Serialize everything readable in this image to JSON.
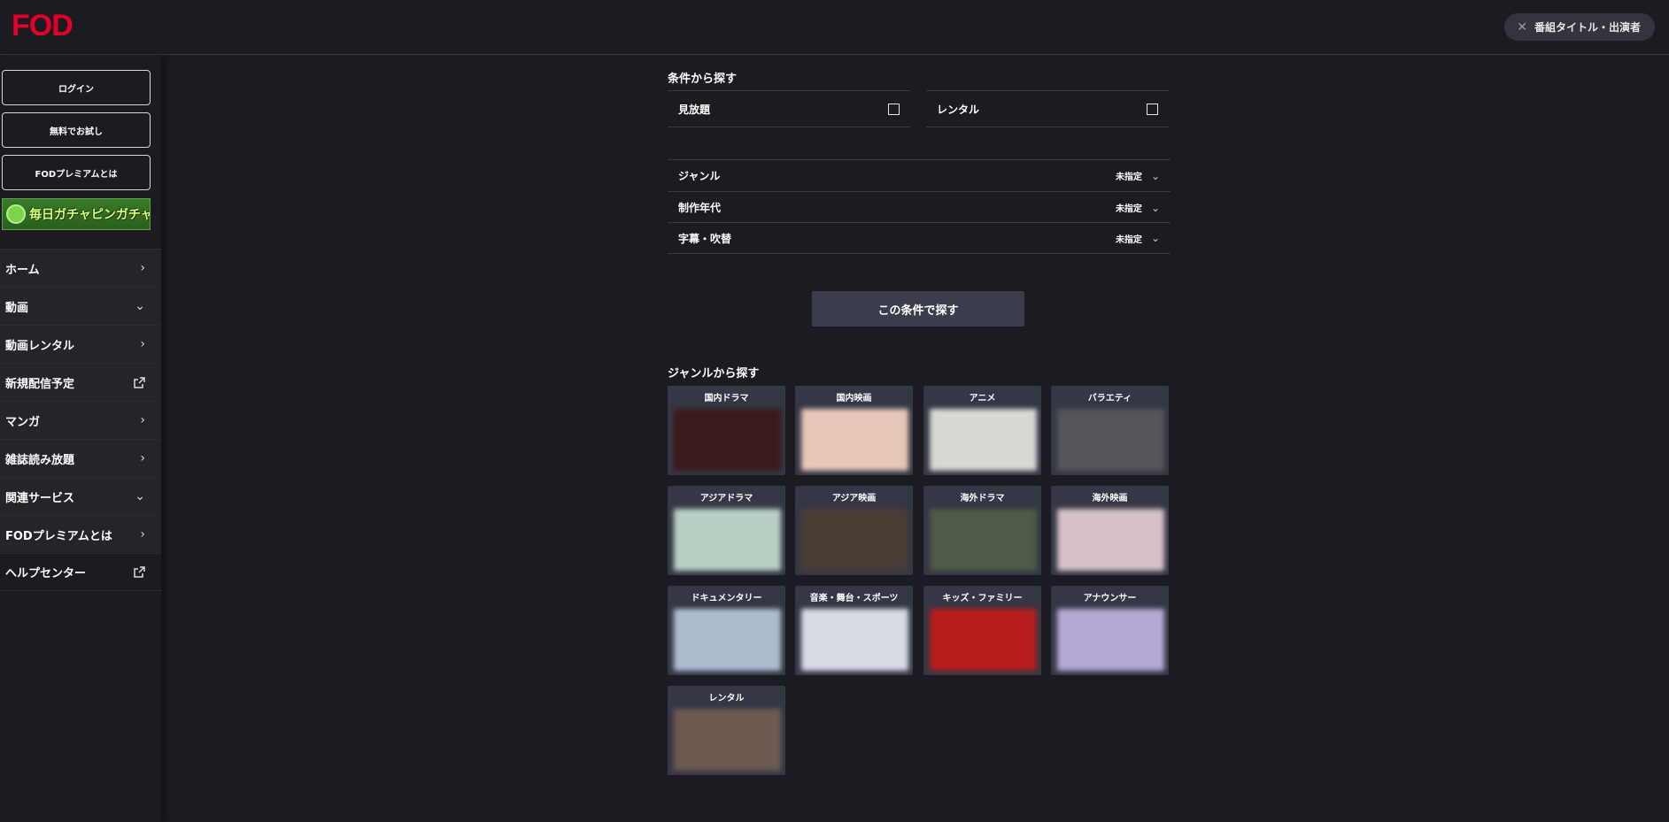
{
  "header": {
    "logo": "FOD",
    "search_chip": {
      "icon": "close-icon",
      "label": "番組タイトル・出演者"
    }
  },
  "sidebar": {
    "buttons": [
      "ログイン",
      "無料でお試し",
      "FODプレミアムとは"
    ],
    "banner": {
      "text": "毎日ガチャピンガチャ"
    },
    "nav": [
      {
        "label": "ホーム",
        "icon": "chevron-right-icon"
      },
      {
        "label": "動画",
        "icon": "chevron-down-icon"
      },
      {
        "label": "動画レンタル",
        "icon": "chevron-right-icon"
      },
      {
        "label": "新規配信予定",
        "icon": "external-link-icon"
      },
      {
        "label": "マンガ",
        "icon": "chevron-right-icon"
      },
      {
        "label": "雑誌読み放題",
        "icon": "chevron-right-icon"
      },
      {
        "label": "関連サービス",
        "icon": "chevron-down-icon"
      },
      {
        "label": "FODプレミアムとは",
        "icon": "chevron-right-icon"
      },
      {
        "label": "ヘルプセンター",
        "icon": "external-link-icon"
      }
    ]
  },
  "conditions": {
    "title": "条件から探す",
    "checkboxes": [
      {
        "label": "見放題",
        "checked": false
      },
      {
        "label": "レンタル",
        "checked": false
      }
    ],
    "filters": [
      {
        "label": "ジャンル",
        "value": "未指定"
      },
      {
        "label": "制作年代",
        "value": "未指定"
      },
      {
        "label": "字幕・吹替",
        "value": "未指定"
      }
    ],
    "search_button": "この条件で探す"
  },
  "genres": {
    "title": "ジャンルから探す",
    "items": [
      {
        "label": "国内ドラマ",
        "thumb": "#3a1a1a"
      },
      {
        "label": "国内映画",
        "thumb": "#e7c8b8"
      },
      {
        "label": "アニメ",
        "thumb": "#d8d8d4"
      },
      {
        "label": "バラエティ",
        "thumb": "#55555a"
      },
      {
        "label": "アジアドラマ",
        "thumb": "#b8cfc4"
      },
      {
        "label": "アジア映画",
        "thumb": "#4a3d36"
      },
      {
        "label": "海外ドラマ",
        "thumb": "#4f5a48"
      },
      {
        "label": "海外映画",
        "thumb": "#d7c0c7"
      },
      {
        "label": "ドキュメンタリー",
        "thumb": "#aebcd0"
      },
      {
        "label": "音楽・舞台・スポーツ",
        "thumb": "#d7dbe4"
      },
      {
        "label": "キッズ・ファミリー",
        "thumb": "#b81d1d"
      },
      {
        "label": "アナウンサー",
        "thumb": "#b5a8d6"
      },
      {
        "label": "レンタル",
        "thumb": "#6e5a50"
      }
    ]
  },
  "colors": {
    "brand": "#e5002b",
    "background": "#1b1b21",
    "card": "#343744",
    "button": "#3a3d4b"
  }
}
